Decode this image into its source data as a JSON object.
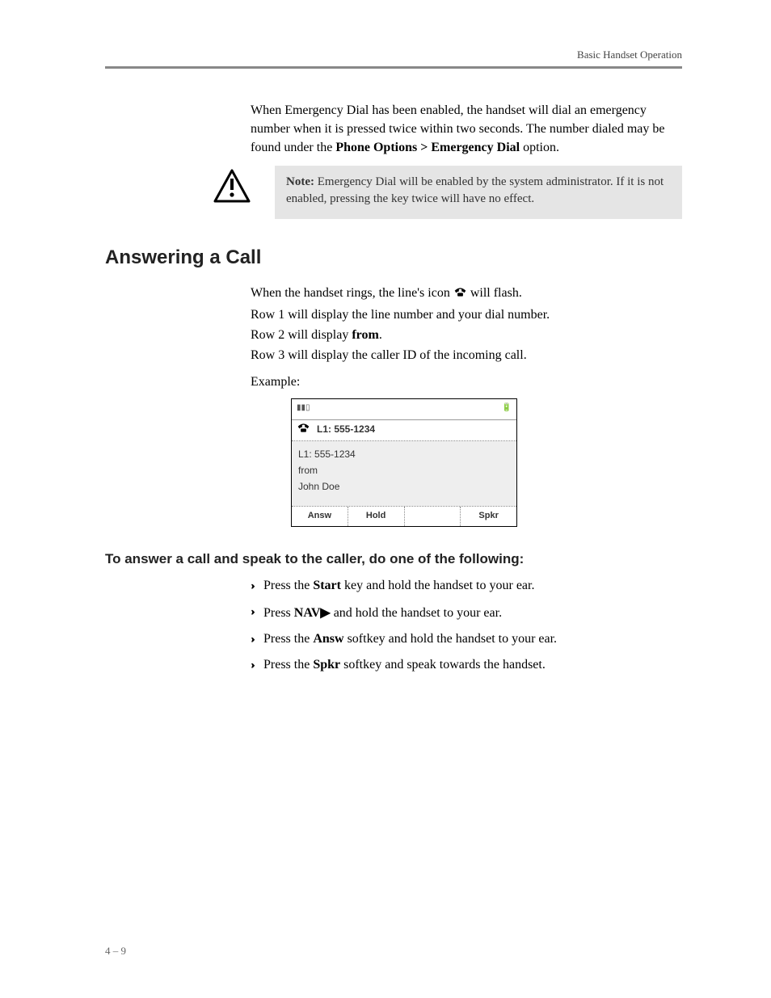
{
  "header": {
    "running": "Basic Handset Operation"
  },
  "intro": {
    "para1_a": "When Emergency Dial has been enabled, the handset will dial an emergency number when it is pressed twice within two seconds. The number dialed may be found under the ",
    "para1_b": "Phone Options > Emergency Dial",
    "para1_c": " option."
  },
  "note": {
    "lead": "Note:",
    "body": " Emergency Dial will be enabled by the system administrator. If it is not enabled, pressing the key twice will have no effect."
  },
  "section": {
    "title": "Answering a Call"
  },
  "ring": {
    "l1a": "When the handset rings, the line's icon ",
    "l1b": " will flash.",
    "l2": "Row 1 will display the line number and your dial number.",
    "l3a": "Row 2 will display ",
    "l3b": "from",
    "l3c": ".",
    "l4": "Row 3 will display the caller ID of the incoming call.",
    "example": "Example:"
  },
  "screen": {
    "line_label": "L1: 555-1234",
    "row1": "L1: 555-1234",
    "row2": "from",
    "row3": "John Doe",
    "sk1": "Answ",
    "sk2": "Hold",
    "sk3": "",
    "sk4": "Spkr"
  },
  "sub": {
    "title": "To answer a call and speak to the caller, do one of the following:"
  },
  "steps": {
    "s1a": "Press the ",
    "s1b": "Start",
    "s1c": " key and hold the handset to your ear.",
    "s2a": "Press ",
    "s2b": "NAV▶",
    "s2c": " and hold the handset to your ear.",
    "s3a": "Press the ",
    "s3b": "Answ",
    "s3c": " softkey and hold the handset to your ear.",
    "s4a": "Press the ",
    "s4b": "Spkr",
    "s4c": " softkey and speak towards the handset."
  },
  "footer": {
    "page": "4 – 9"
  },
  "icons": {
    "phone_line": "phone-on-hook-icon",
    "warn": "warning-triangle-icon"
  }
}
